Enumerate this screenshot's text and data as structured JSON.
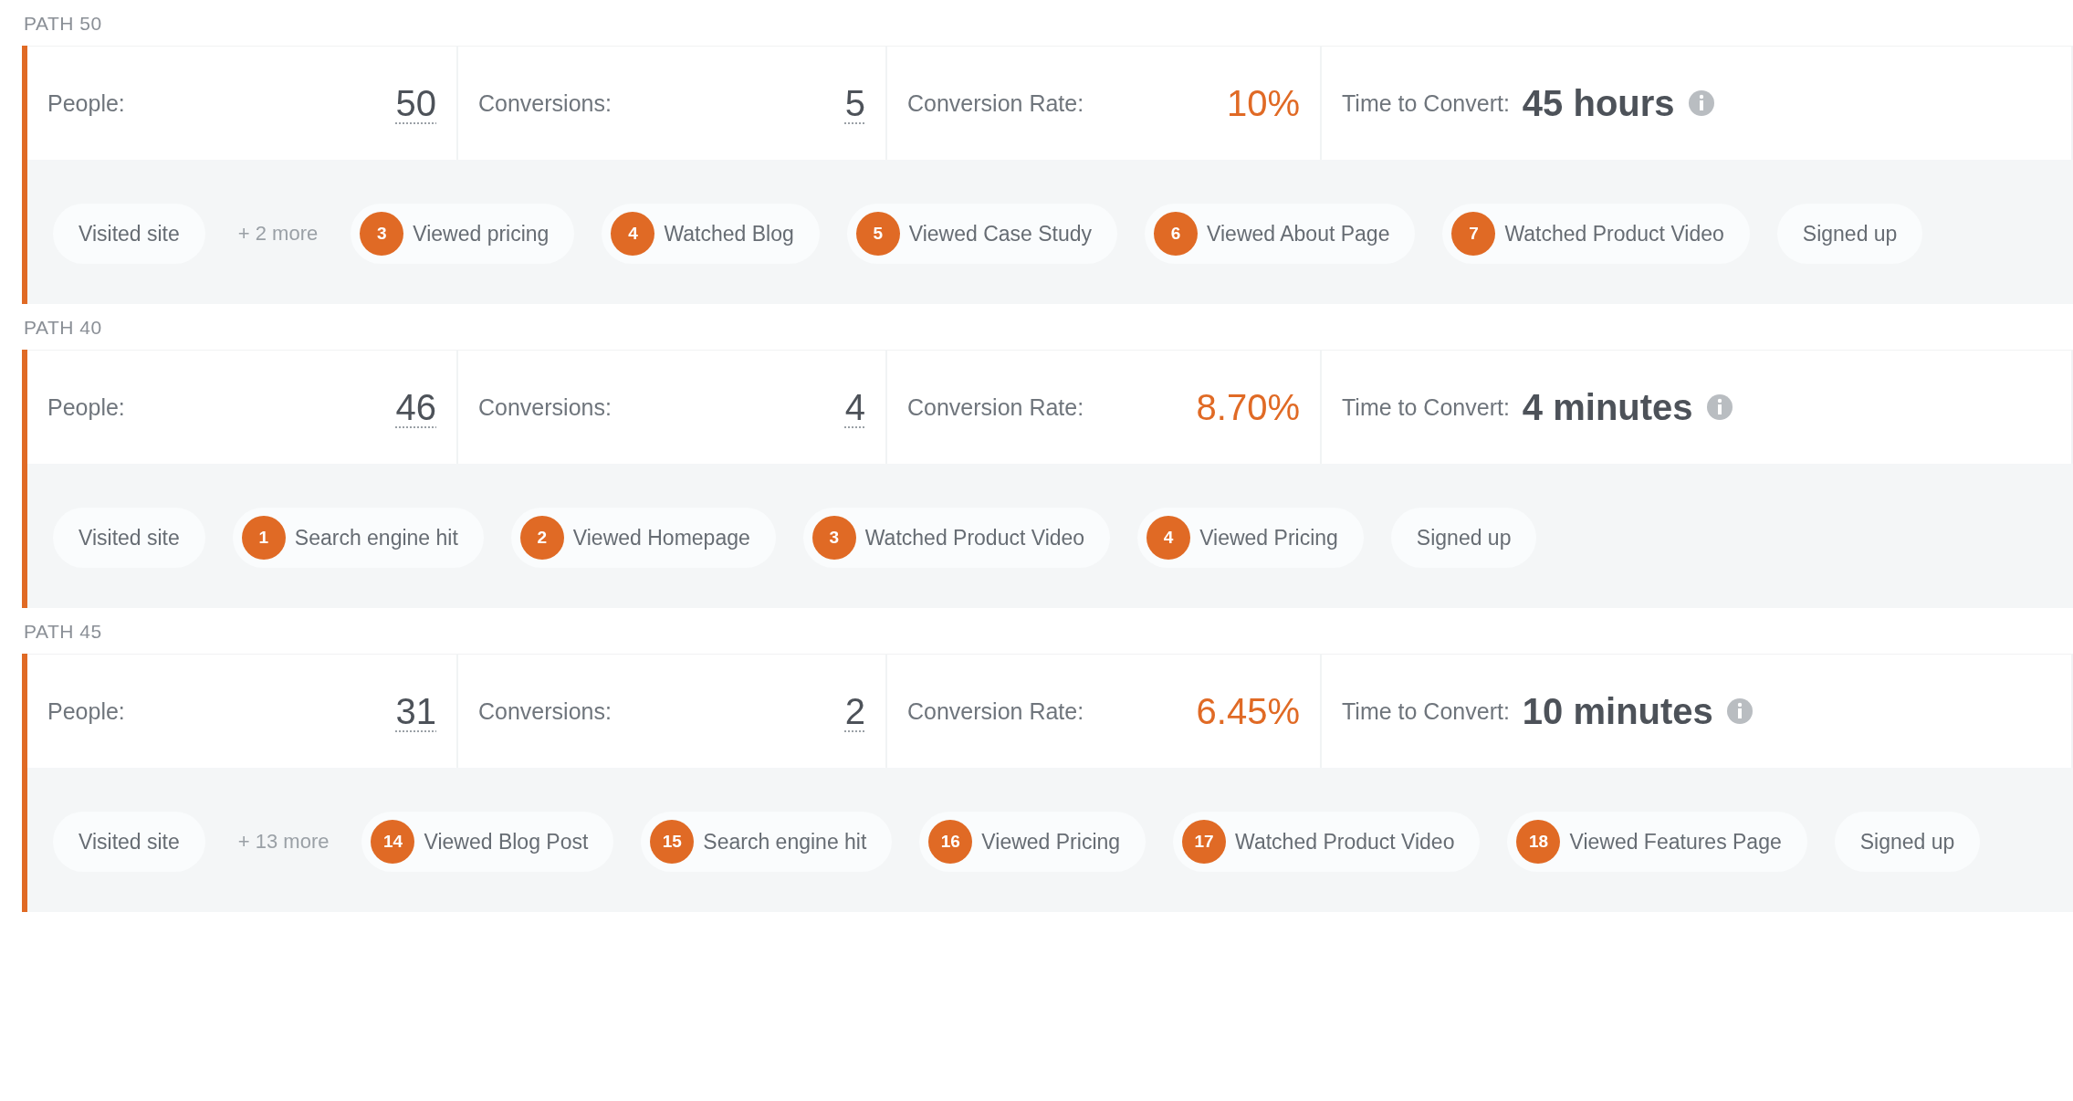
{
  "paths": [
    {
      "title": "PATH 50",
      "people_label": "People:",
      "people": "50",
      "conversions_label": "Conversions:",
      "conversions": "5",
      "rate_label": "Conversion Rate:",
      "rate": "10%",
      "time_label": "Time to Convert:",
      "time": "45 hours",
      "steps": [
        {
          "kind": "plain",
          "label": "Visited site"
        },
        {
          "kind": "more",
          "label": "+ 2 more"
        },
        {
          "kind": "numbered",
          "number": "3",
          "label": "Viewed pricing"
        },
        {
          "kind": "numbered",
          "number": "4",
          "label": "Watched Blog"
        },
        {
          "kind": "numbered",
          "number": "5",
          "label": "Viewed Case Study"
        },
        {
          "kind": "numbered",
          "number": "6",
          "label": "Viewed About Page"
        },
        {
          "kind": "numbered",
          "number": "7",
          "label": "Watched Product Video"
        },
        {
          "kind": "plain",
          "label": "Signed up"
        }
      ]
    },
    {
      "title": "PATH 40",
      "people_label": "People:",
      "people": "46",
      "conversions_label": "Conversions:",
      "conversions": "4",
      "rate_label": "Conversion Rate:",
      "rate": "8.70%",
      "time_label": "Time to Convert:",
      "time": "4 minutes",
      "steps": [
        {
          "kind": "plain",
          "label": "Visited site"
        },
        {
          "kind": "numbered",
          "number": "1",
          "label": "Search engine hit"
        },
        {
          "kind": "numbered",
          "number": "2",
          "label": "Viewed Homepage"
        },
        {
          "kind": "numbered",
          "number": "3",
          "label": "Watched Product Video"
        },
        {
          "kind": "numbered",
          "number": "4",
          "label": "Viewed Pricing"
        },
        {
          "kind": "plain",
          "label": "Signed up"
        }
      ]
    },
    {
      "title": "PATH 45",
      "people_label": "People:",
      "people": "31",
      "conversions_label": "Conversions:",
      "conversions": "2",
      "rate_label": "Conversion Rate:",
      "rate": "6.45%",
      "time_label": "Time to Convert:",
      "time": "10 minutes",
      "steps": [
        {
          "kind": "plain",
          "label": "Visited site"
        },
        {
          "kind": "more",
          "label": "+ 13 more"
        },
        {
          "kind": "numbered",
          "number": "14",
          "label": "Viewed Blog Post"
        },
        {
          "kind": "numbered",
          "number": "15",
          "label": "Search engine hit"
        },
        {
          "kind": "numbered",
          "number": "16",
          "label": "Viewed Pricing"
        },
        {
          "kind": "numbered",
          "number": "17",
          "label": "Watched Product Video"
        },
        {
          "kind": "numbered",
          "number": "18",
          "label": "Viewed Features Page"
        },
        {
          "kind": "plain",
          "label": "Signed up"
        }
      ]
    }
  ]
}
